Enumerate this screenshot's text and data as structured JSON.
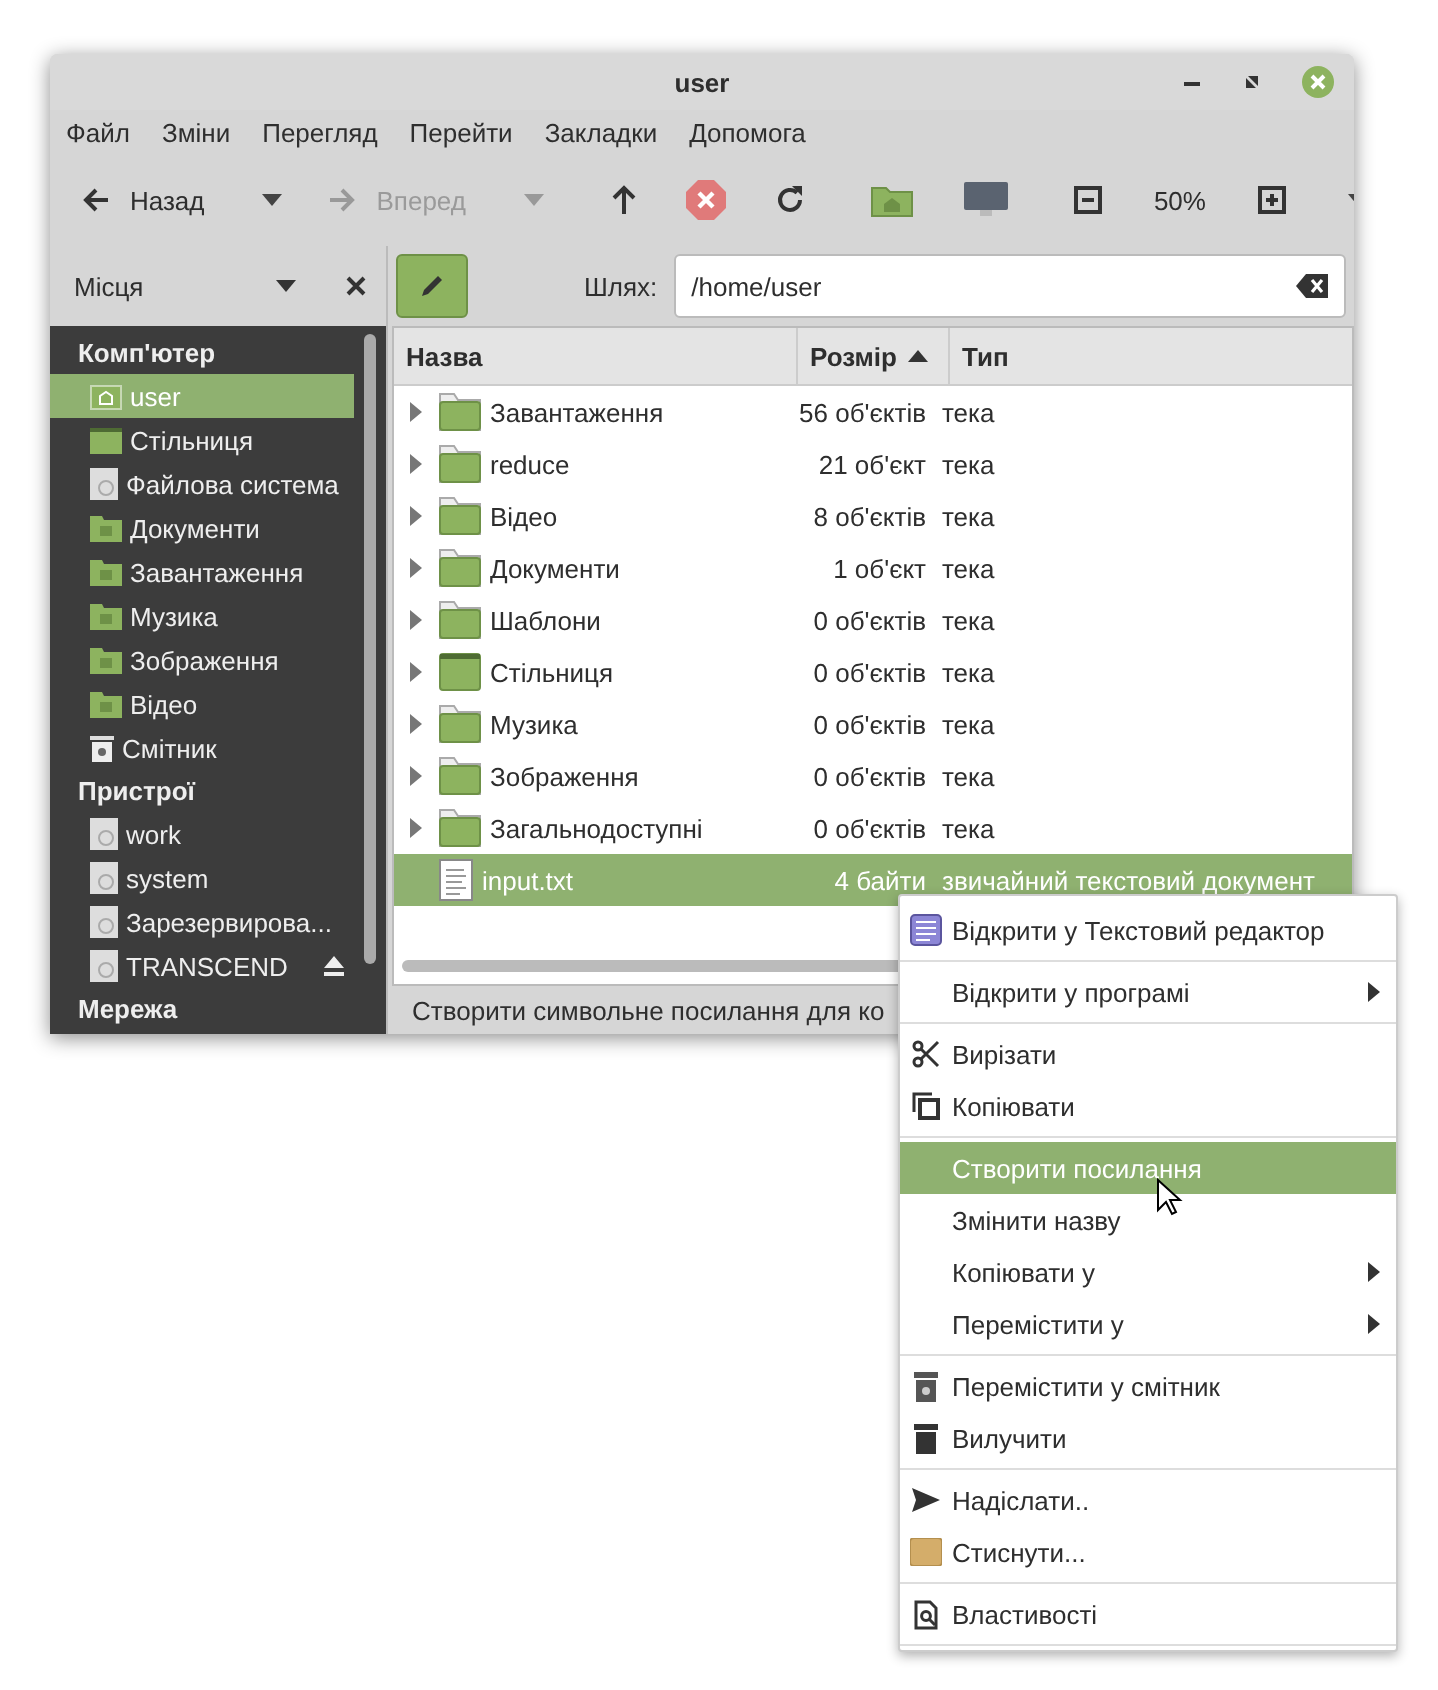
{
  "window": {
    "title": "user"
  },
  "menubar": [
    "Файл",
    "Зміни",
    "Перегляд",
    "Перейти",
    "Закладки",
    "Допомога"
  ],
  "toolbar": {
    "back": {
      "label": "Назад",
      "disabled": false
    },
    "forward": {
      "label": "Вперед",
      "disabled": true
    },
    "zoom": "50%"
  },
  "sidebar": {
    "title": "Місця",
    "sections": [
      {
        "heading": "Комп'ютер",
        "items": [
          {
            "label": "user",
            "kind": "home",
            "selected": true,
            "ejectable": false
          },
          {
            "label": "Стільниця",
            "kind": "desktop",
            "selected": false,
            "ejectable": false
          },
          {
            "label": "Файлова система",
            "kind": "drive",
            "selected": false,
            "ejectable": false
          },
          {
            "label": "Документи",
            "kind": "folder",
            "selected": false,
            "ejectable": false
          },
          {
            "label": "Завантаження",
            "kind": "folder",
            "selected": false,
            "ejectable": false
          },
          {
            "label": "Музика",
            "kind": "folder",
            "selected": false,
            "ejectable": false
          },
          {
            "label": "Зображення",
            "kind": "folder",
            "selected": false,
            "ejectable": false
          },
          {
            "label": "Відео",
            "kind": "folder",
            "selected": false,
            "ejectable": false
          },
          {
            "label": "Смітник",
            "kind": "trash",
            "selected": false,
            "ejectable": false
          }
        ]
      },
      {
        "heading": "Пристрої",
        "items": [
          {
            "label": "work",
            "kind": "drive",
            "selected": false,
            "ejectable": false
          },
          {
            "label": "system",
            "kind": "drive",
            "selected": false,
            "ejectable": false
          },
          {
            "label": "Зарезервирова...",
            "kind": "drive",
            "selected": false,
            "ejectable": false
          },
          {
            "label": "TRANSCEND",
            "kind": "drive",
            "selected": false,
            "ejectable": true
          }
        ]
      },
      {
        "heading": "Мережа"
      }
    ]
  },
  "path": {
    "label": "Шлях:",
    "value": "/home/user"
  },
  "table": {
    "columns": [
      {
        "label": "Назва",
        "sorted": false
      },
      {
        "label": "Розмір",
        "sorted": true
      },
      {
        "label": "Тип",
        "sorted": false
      }
    ],
    "rows": [
      {
        "name": "Завантаження",
        "size": "56 об'єктів",
        "type": "тека",
        "kind": "folder",
        "selected": false
      },
      {
        "name": "reduce",
        "size": "21 об'єкт",
        "type": "тека",
        "kind": "folder",
        "selected": false
      },
      {
        "name": "Відео",
        "size": "8 об'єктів",
        "type": "тека",
        "kind": "folder",
        "selected": false
      },
      {
        "name": "Документи",
        "size": "1 об'єкт",
        "type": "тека",
        "kind": "folder",
        "selected": false
      },
      {
        "name": "Шаблони",
        "size": "0 об'єктів",
        "type": "тека",
        "kind": "folder",
        "selected": false
      },
      {
        "name": "Стільниця",
        "size": "0 об'єктів",
        "type": "тека",
        "kind": "desktop",
        "selected": false
      },
      {
        "name": "Музика",
        "size": "0 об'єктів",
        "type": "тека",
        "kind": "folder",
        "selected": false
      },
      {
        "name": "Зображення",
        "size": "0 об'єктів",
        "type": "тека",
        "kind": "folder",
        "selected": false
      },
      {
        "name": "Загальнодоступні",
        "size": "0 об'єктів",
        "type": "тека",
        "kind": "folder",
        "selected": false
      },
      {
        "name": "input.txt",
        "size": "4 байти",
        "type": "звичайний текстовий документ",
        "kind": "file",
        "selected": true
      }
    ]
  },
  "status_bar": "Створити символьне посилання для ко",
  "context_menu": {
    "groups": [
      [
        {
          "label": "Відкрити у Текстовий редактор",
          "kind": "editor",
          "submenu": false,
          "selected": false
        }
      ],
      [
        {
          "label": "Відкрити у програмі",
          "kind": "plain",
          "submenu": true,
          "selected": false
        }
      ],
      [
        {
          "label": "Вирізати",
          "kind": "cut",
          "submenu": false,
          "selected": false
        },
        {
          "label": "Копіювати",
          "kind": "copy",
          "submenu": false,
          "selected": false
        }
      ],
      [
        {
          "label": "Створити посилання",
          "kind": "plain",
          "submenu": false,
          "selected": true
        },
        {
          "label": "Змінити назву",
          "kind": "plain",
          "submenu": false,
          "selected": false
        },
        {
          "label": "Копіювати у",
          "kind": "plain",
          "submenu": true,
          "selected": false
        },
        {
          "label": "Перемістити у",
          "kind": "plain",
          "submenu": true,
          "selected": false
        }
      ],
      [
        {
          "label": "Перемістити у смітник",
          "kind": "trash",
          "submenu": false,
          "selected": false
        },
        {
          "label": "Вилучити",
          "kind": "delete",
          "submenu": false,
          "selected": false
        }
      ],
      [
        {
          "label": "Надіслати..",
          "kind": "send",
          "submenu": false,
          "selected": false
        },
        {
          "label": "Стиснути...",
          "kind": "archive",
          "submenu": false,
          "selected": false
        }
      ],
      [
        {
          "label": "Властивості",
          "kind": "properties",
          "submenu": false,
          "selected": false
        }
      ]
    ]
  }
}
